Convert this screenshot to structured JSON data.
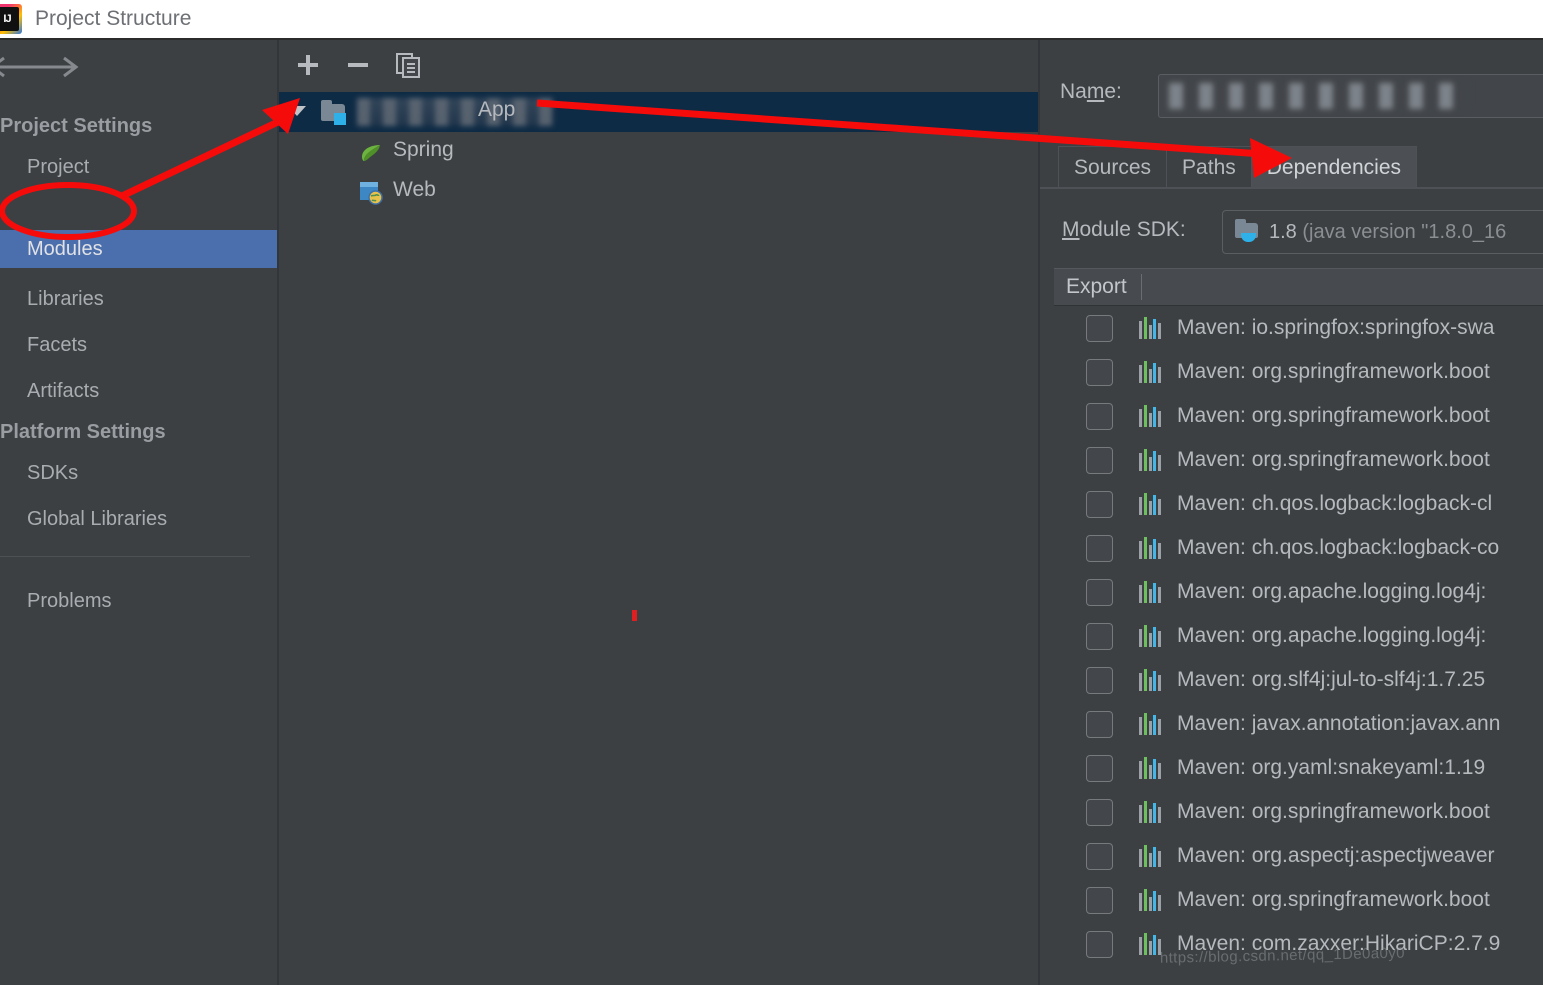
{
  "window": {
    "title": "Project Structure",
    "logo_icon": "intellij-idea-logo"
  },
  "nav": {
    "back_icon": "arrow-left-icon",
    "forward_icon": "arrow-right-icon"
  },
  "sidebar": {
    "sections": [
      {
        "heading": "Project Settings",
        "items": [
          {
            "label": "Project",
            "selected": false
          },
          {
            "label": "Modules",
            "selected": true
          },
          {
            "label": "Libraries",
            "selected": false
          },
          {
            "label": "Facets",
            "selected": false
          },
          {
            "label": "Artifacts",
            "selected": false
          }
        ]
      },
      {
        "heading": "Platform Settings",
        "items": [
          {
            "label": "SDKs",
            "selected": false
          },
          {
            "label": "Global Libraries",
            "selected": false
          }
        ]
      }
    ],
    "problems": {
      "label": "Problems"
    }
  },
  "tree_panel": {
    "toolbar": {
      "add_label": "+",
      "remove_label": "−",
      "copy_icon": "copy-icon"
    },
    "module": {
      "name_redacted": true,
      "name_suffix": "App",
      "expanded": true,
      "selected": true,
      "icon": "module-folder-icon",
      "children": [
        {
          "label": "Spring",
          "icon": "spring-leaf-icon"
        },
        {
          "label": "Web",
          "icon": "web-globe-icon"
        }
      ]
    }
  },
  "detail": {
    "name_field": {
      "label_prefix": "Na",
      "label_mnemonic": "m",
      "label_suffix": "e:",
      "value_redacted": true
    },
    "tabs": [
      {
        "label": "Sources",
        "active": false
      },
      {
        "label": "Paths",
        "active": false
      },
      {
        "label": "Dependencies",
        "active": true
      }
    ],
    "module_sdk": {
      "label_mnemonic": "M",
      "label_rest": "odule SDK:",
      "icon": "java-sdk-icon",
      "version": "1.8",
      "detail": "(java version \"1.8.0_16"
    },
    "table": {
      "columns": [
        "Export"
      ],
      "rows": [
        {
          "checked": false,
          "icon": "maven-icon",
          "label": "Maven: io.springfox:springfox-swa"
        },
        {
          "checked": false,
          "icon": "maven-icon",
          "label": "Maven: org.springframework.boot"
        },
        {
          "checked": false,
          "icon": "maven-icon",
          "label": "Maven: org.springframework.boot"
        },
        {
          "checked": false,
          "icon": "maven-icon",
          "label": "Maven: org.springframework.boot"
        },
        {
          "checked": false,
          "icon": "maven-icon",
          "label": "Maven: ch.qos.logback:logback-cl"
        },
        {
          "checked": false,
          "icon": "maven-icon",
          "label": "Maven: ch.qos.logback:logback-co"
        },
        {
          "checked": false,
          "icon": "maven-icon",
          "label": "Maven: org.apache.logging.log4j:"
        },
        {
          "checked": false,
          "icon": "maven-icon",
          "label": "Maven: org.apache.logging.log4j:"
        },
        {
          "checked": false,
          "icon": "maven-icon",
          "label": "Maven: org.slf4j:jul-to-slf4j:1.7.25"
        },
        {
          "checked": false,
          "icon": "maven-icon",
          "label": "Maven: javax.annotation:javax.ann"
        },
        {
          "checked": false,
          "icon": "maven-icon",
          "label": "Maven: org.yaml:snakeyaml:1.19"
        },
        {
          "checked": false,
          "icon": "maven-icon",
          "label": "Maven: org.springframework.boot"
        },
        {
          "checked": false,
          "icon": "maven-icon",
          "label": "Maven: org.aspectj:aspectjweaver"
        },
        {
          "checked": false,
          "icon": "maven-icon",
          "label": "Maven: org.springframework.boot"
        },
        {
          "checked": false,
          "icon": "maven-icon",
          "label": "Maven: com.zaxxer:HikariCP:2.7.9"
        }
      ]
    }
  },
  "annotations": {
    "accent_color": "#f60b0b",
    "ellipse_target": "Modules",
    "arrow_1": "from Modules sidebar item to module tree root",
    "arrow_2": "from module tree root to Dependencies tab"
  },
  "watermark": {
    "text": "https://blog.csdn.net/qq_1De0a0y0"
  },
  "colors": {
    "panel_bg": "#3c4043",
    "sidebar_selected": "#4b6eac",
    "tree_selected": "#0e2b45",
    "titlebar_bg": "#ffffff",
    "text": "#b6b9bd",
    "annotation_red": "#f60b0b"
  }
}
